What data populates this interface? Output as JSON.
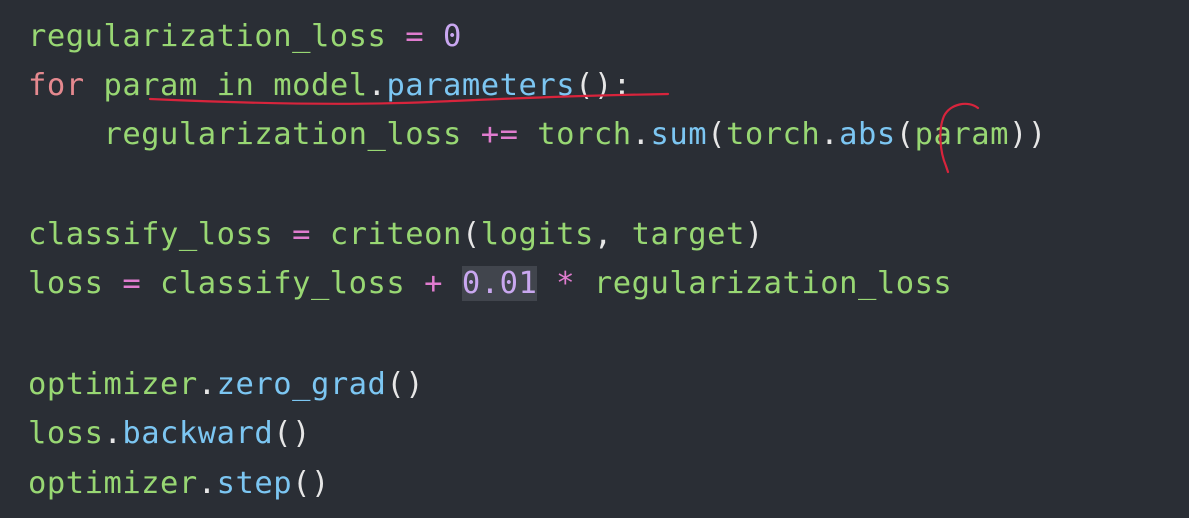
{
  "code": {
    "line1": {
      "a": "regularization_loss",
      "b": " = ",
      "c": "0"
    },
    "line2": {
      "a": "for",
      "b": " param ",
      "c": "in",
      "d": " model",
      "e": ".",
      "f": "parameters",
      "g": "():"
    },
    "line3": {
      "indent": "    ",
      "a": "regularization_loss",
      "b": " += ",
      "c": "torch",
      "d": ".",
      "e": "sum",
      "f": "(",
      "g": "torch",
      "h": ".",
      "i": "abs",
      "j": "(",
      "k": "param",
      "l": "))"
    },
    "line5": {
      "a": "classify_loss",
      "b": " = ",
      "c": "criteon",
      "d": "(",
      "e": "logits",
      "f": ", ",
      "g": "target",
      "h": ")"
    },
    "line6": {
      "a": "loss",
      "b": " = ",
      "c": "classify_loss",
      "d": " + ",
      "e": "0.01",
      "f": " * ",
      "g": "regularization_loss"
    },
    "line8": {
      "a": "optimizer",
      "b": ".",
      "c": "zero_grad",
      "d": "()"
    },
    "line9": {
      "a": "loss",
      "b": ".",
      "c": "backward",
      "d": "()"
    },
    "line10": {
      "a": "optimizer",
      "b": ".",
      "c": "step",
      "d": "()"
    }
  },
  "colors": {
    "background": "#2a2e35",
    "identifier": "#98d773",
    "keyword": "#e5898f",
    "operator": "#e07ccf",
    "number": "#c9a7f0",
    "function": "#7cc6f2",
    "punctuation": "#e6e6e6",
    "annotation": "#d8243c"
  }
}
